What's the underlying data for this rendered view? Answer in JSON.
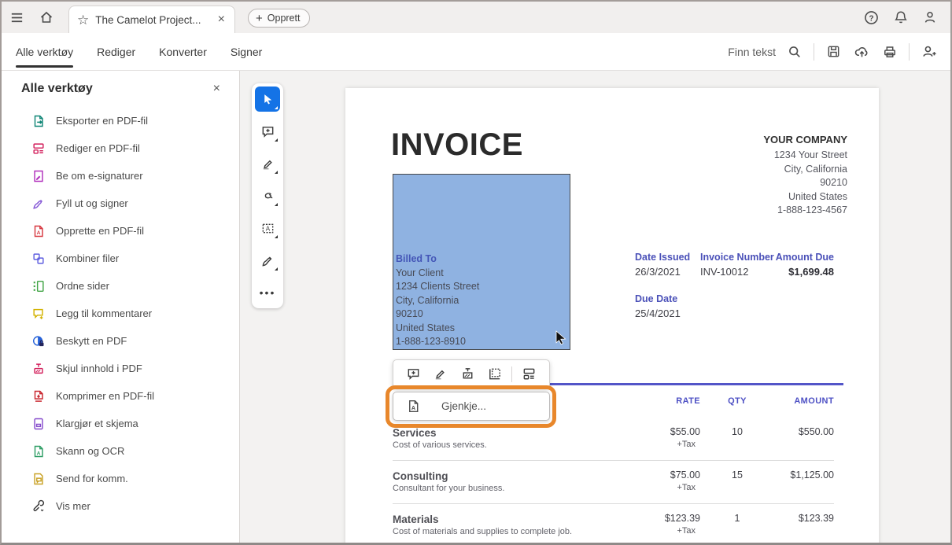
{
  "topbar": {
    "tab_title": "The Camelot Project...",
    "create_button": "Opprett"
  },
  "toolbar": {
    "tabs": [
      {
        "label": "Alle verktøy",
        "active": true
      },
      {
        "label": "Rediger",
        "active": false
      },
      {
        "label": "Konverter",
        "active": false
      },
      {
        "label": "Signer",
        "active": false
      }
    ],
    "find_text_label": "Finn tekst",
    "icons": [
      "search-icon",
      "save-icon",
      "cloud-upload-icon",
      "print-icon",
      "add-person-icon"
    ]
  },
  "sidebar": {
    "title": "Alle verktøy",
    "items": [
      {
        "label": "Eksporter en PDF-fil",
        "icon": "export-pdf-icon",
        "color": "#0E8575"
      },
      {
        "label": "Rediger en PDF-fil",
        "icon": "edit-pdf-icon",
        "color": "#D3215D"
      },
      {
        "label": "Be om e-signaturer",
        "icon": "request-esign-icon",
        "color": "#B130BD"
      },
      {
        "label": "Fyll ut og signer",
        "icon": "fill-sign-icon",
        "color": "#8659D6"
      },
      {
        "label": "Opprette en PDF-fil",
        "icon": "create-pdf-icon",
        "color": "#D7373F"
      },
      {
        "label": "Kombiner filer",
        "icon": "combine-files-icon",
        "color": "#5F5FE0"
      },
      {
        "label": "Ordne sider",
        "icon": "organize-pages-icon",
        "color": "#43A547"
      },
      {
        "label": "Legg til kommentarer",
        "icon": "add-comments-icon",
        "color": "#D2B200"
      },
      {
        "label": "Beskytt en PDF",
        "icon": "protect-pdf-icon",
        "color": "#2662D9"
      },
      {
        "label": "Skjul innhold i PDF",
        "icon": "redact-pdf-icon",
        "color": "#D3215D"
      },
      {
        "label": "Komprimer en PDF-fil",
        "icon": "compress-pdf-icon",
        "color": "#C9252D"
      },
      {
        "label": "Klargjør et skjema",
        "icon": "prepare-form-icon",
        "color": "#864CCC"
      },
      {
        "label": "Skann og OCR",
        "icon": "scan-ocr-icon",
        "color": "#2D9D64"
      },
      {
        "label": "Send for komm.",
        "icon": "send-comments-icon",
        "color": "#C9A227"
      },
      {
        "label": "Vis mer",
        "icon": "show-more-icon",
        "color": "#3A3A3A"
      }
    ]
  },
  "quick_tools": [
    "select-tool",
    "add-comment-tool",
    "highlight-tool",
    "draw-tool",
    "add-text-tool",
    "sign-tool",
    "more-tools"
  ],
  "context_toolbar": {
    "tools": [
      "add-comment",
      "highlight",
      "redact",
      "crop",
      "edit-pdf"
    ]
  },
  "ocr_menu": {
    "label": "Gjenkje..."
  },
  "invoice": {
    "title": "INVOICE",
    "company": {
      "name": "YOUR COMPANY",
      "line1": "1234 Your Street",
      "line2": "City, California",
      "line3": "90210",
      "line4": "United States",
      "line5": "1-888-123-4567"
    },
    "billed_to": {
      "label": "Billed To",
      "line1": "Your Client",
      "line2": "1234 Clients Street",
      "line3": "City, California",
      "line4": "90210",
      "line5": "United States",
      "line6": "1-888-123-8910"
    },
    "meta": {
      "date_issued_label": "Date Issued",
      "date_issued": "26/3/2021",
      "invoice_number_label": "Invoice Number",
      "invoice_number": "INV-10012",
      "amount_due_label": "Amount Due",
      "amount_due": "$1,699.48",
      "due_date_label": "Due Date",
      "due_date": "25/4/2021"
    },
    "table": {
      "headers": {
        "rate": "RATE",
        "qty": "QTY",
        "amount": "AMOUNT"
      },
      "rows": [
        {
          "item": "Services",
          "description": "Cost of various services.",
          "rate": "$55.00",
          "tax": "+Tax",
          "qty": "10",
          "amount": "$550.00"
        },
        {
          "item": "Consulting",
          "description": "Consultant for your business.",
          "rate": "$75.00",
          "tax": "+Tax",
          "qty": "15",
          "amount": "$1,125.00"
        },
        {
          "item": "Materials",
          "description": "Cost of materials and supplies to complete job.",
          "rate": "$123.39",
          "tax": "+Tax",
          "qty": "1",
          "amount": "$123.39"
        }
      ]
    }
  },
  "colors": {
    "accent_blue": "#1473E6",
    "invoice_accent": "#4E52BE",
    "selection_fill": "#8FB2E1",
    "highlight_orange": "#E8872B"
  }
}
